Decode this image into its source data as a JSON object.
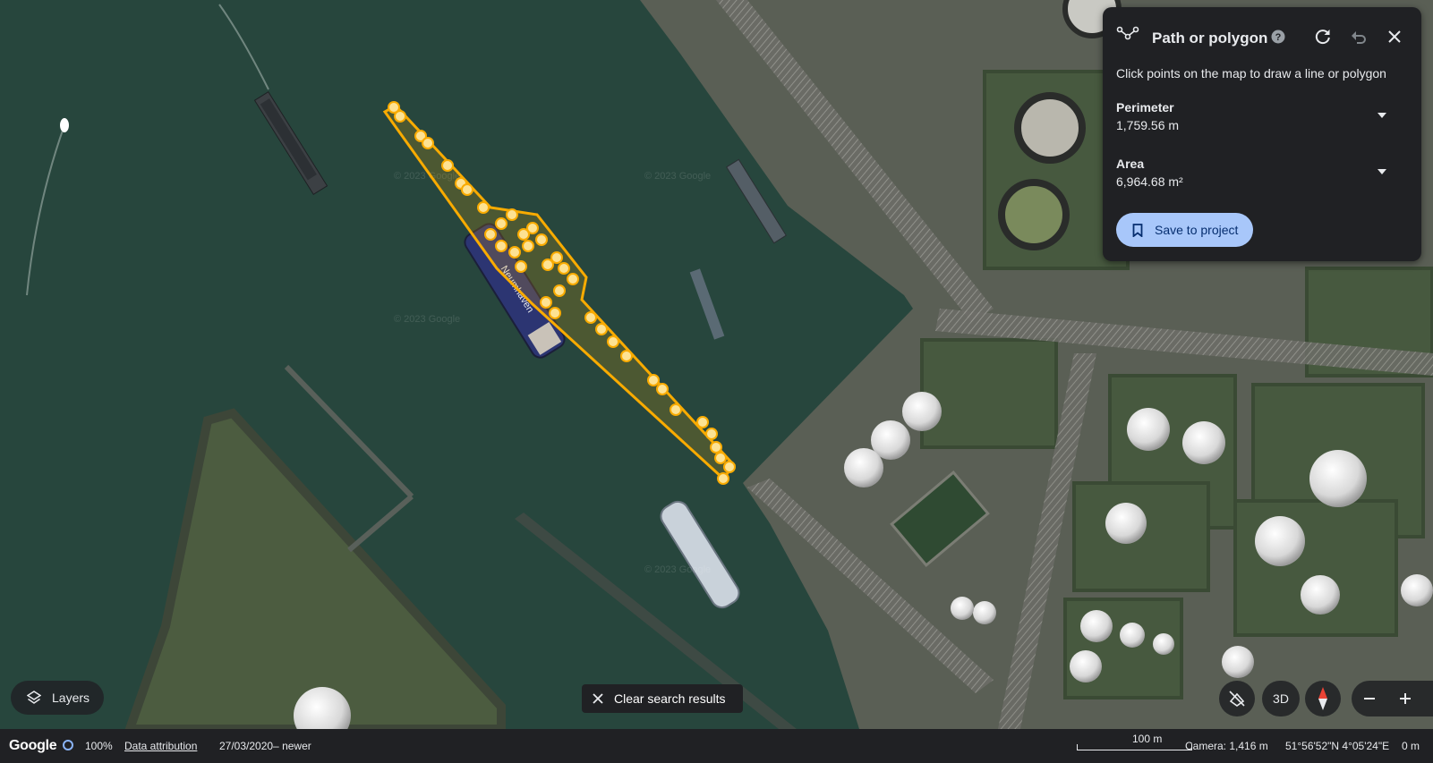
{
  "panel": {
    "title": "Path or polygon",
    "hint": "Click points on the map to draw a line or polygon",
    "perimeter_label": "Perimeter",
    "perimeter_value": "1,759.56 m",
    "area_label": "Area",
    "area_value": "6,964.68 m²",
    "save_label": "Save to project",
    "icons": [
      "path-icon",
      "help-icon",
      "redo-icon",
      "undo-icon",
      "close-icon",
      "chevron-down-icon",
      "bookmark-icon"
    ]
  },
  "map": {
    "ship_name": "Neumhaven",
    "watermark": "© 2023 Google",
    "path_color": "#f9ab00",
    "vertex_color": "#fde293"
  },
  "controls": {
    "layers_label": "Layers",
    "clear_label": "Clear search results",
    "three_d_label": "3D"
  },
  "status": {
    "logo": "Google",
    "loading": "100%",
    "data_attribution": "Data attribution",
    "imagery_date": "27/03/2020– newer",
    "scale": "100 m",
    "camera": "Camera: 1,416 m",
    "coordinates": "51°56'52\"N 4°05'24\"E",
    "elevation": "0 m"
  },
  "colors": {
    "water": "#27463d",
    "land": "#4e5a48",
    "panel_bg": "#202124",
    "accent": "#a8c7fa"
  }
}
